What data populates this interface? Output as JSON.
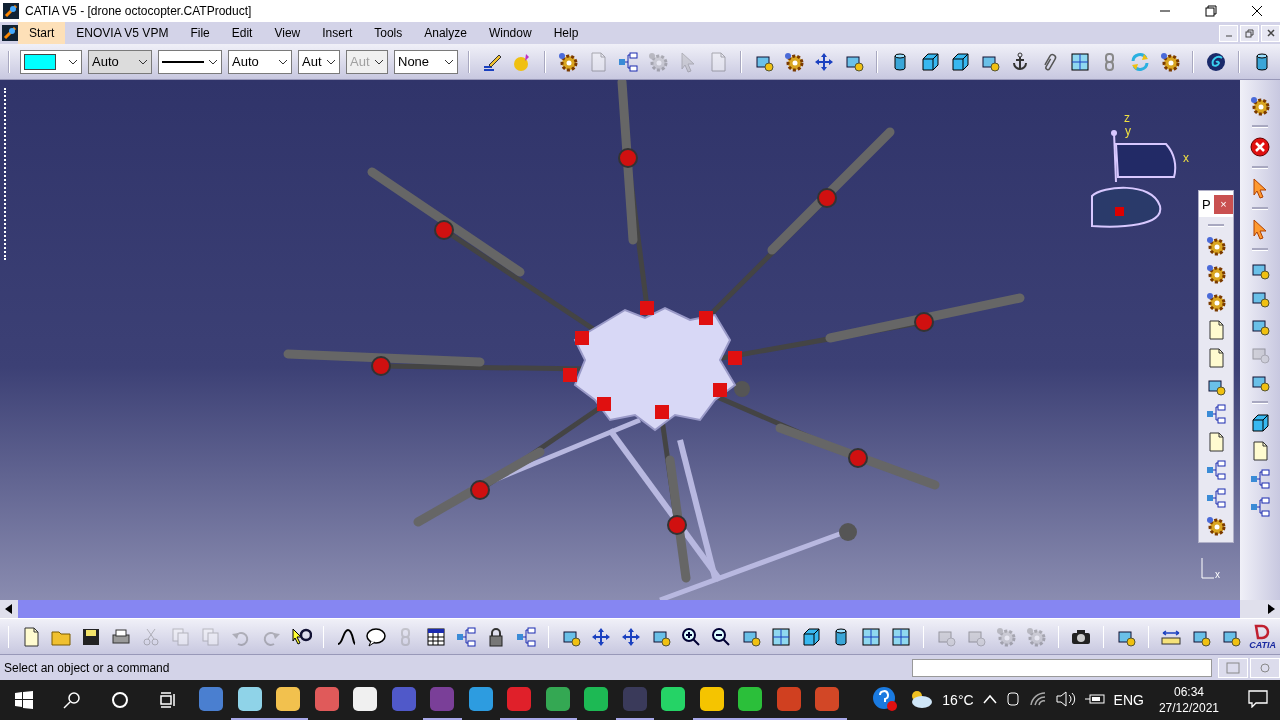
{
  "window": {
    "title": "CATIA V5 - [drone octocopter.CATProduct]"
  },
  "menu": [
    {
      "label": "Start",
      "selected": true
    },
    {
      "label": "ENOVIA V5 VPM",
      "selected": false
    },
    {
      "label": "File",
      "selected": false
    },
    {
      "label": "Edit",
      "selected": false
    },
    {
      "label": "View",
      "selected": false
    },
    {
      "label": "Insert",
      "selected": false
    },
    {
      "label": "Tools",
      "selected": false
    },
    {
      "label": "Analyze",
      "selected": false
    },
    {
      "label": "Window",
      "selected": false
    },
    {
      "label": "Help",
      "selected": false
    }
  ],
  "format_toolbar": [
    {
      "kind": "color",
      "color": "#00ffff",
      "disabled": false
    },
    {
      "kind": "text",
      "value": "Auto",
      "readonly": true,
      "disabled": false
    },
    {
      "kind": "line",
      "disabled": false
    },
    {
      "kind": "text",
      "value": "Auto",
      "readonly": false,
      "disabled": false
    },
    {
      "kind": "text",
      "value": "Aut",
      "readonly": false,
      "disabled": false
    },
    {
      "kind": "text",
      "value": "Aut",
      "readonly": false,
      "disabled": true
    },
    {
      "kind": "text",
      "value": "None",
      "readonly": false,
      "disabled": false
    }
  ],
  "top_toolbar": [
    [
      {
        "kind": "brush",
        "disabled": false
      },
      {
        "kind": "ball",
        "disabled": false
      }
    ],
    [
      {
        "kind": "gear",
        "disabled": false
      },
      {
        "kind": "page",
        "disabled": true
      },
      {
        "kind": "tree",
        "disabled": false
      },
      {
        "kind": "gear",
        "disabled": true
      },
      {
        "kind": "cursor",
        "disabled": true
      },
      {
        "kind": "page",
        "disabled": true
      }
    ],
    [
      {
        "kind": "tool",
        "disabled": false
      },
      {
        "kind": "gear",
        "disabled": false
      },
      {
        "kind": "move",
        "disabled": false
      },
      {
        "kind": "tool",
        "disabled": false
      }
    ],
    [
      {
        "kind": "cylinder",
        "disabled": false
      },
      {
        "kind": "cube",
        "disabled": false
      },
      {
        "kind": "cube",
        "disabled": false
      },
      {
        "kind": "tool",
        "disabled": false
      },
      {
        "kind": "anchor",
        "disabled": false
      },
      {
        "kind": "clip",
        "disabled": false
      },
      {
        "kind": "window",
        "disabled": false
      },
      {
        "kind": "link",
        "disabled": false
      },
      {
        "kind": "refresh",
        "disabled": false
      },
      {
        "kind": "gear",
        "disabled": false
      }
    ],
    [
      {
        "kind": "swirl",
        "disabled": false
      }
    ],
    [
      {
        "kind": "cylinder",
        "disabled": false
      }
    ]
  ],
  "compass": {
    "z": "z",
    "y": "y",
    "x": "x"
  },
  "floating_toolbar": {
    "title": "P",
    "close": "×",
    "icons": [
      {
        "kind": "gear",
        "disabled": false
      },
      {
        "kind": "gear",
        "disabled": false
      },
      {
        "kind": "gear",
        "disabled": false
      },
      {
        "kind": "page",
        "disabled": false
      },
      {
        "kind": "page",
        "disabled": false
      },
      {
        "kind": "tool",
        "disabled": false
      },
      {
        "kind": "tree",
        "disabled": false
      },
      {
        "kind": "page",
        "disabled": false
      },
      {
        "kind": "tree",
        "disabled": false
      },
      {
        "kind": "tree",
        "disabled": false
      },
      {
        "kind": "gear",
        "disabled": false
      }
    ]
  },
  "right_toolbar": [
    [
      {
        "kind": "gear",
        "disabled": false
      }
    ],
    [
      {
        "kind": "stop",
        "disabled": false
      }
    ],
    [
      {
        "kind": "cursor",
        "disabled": false
      }
    ],
    [
      {
        "kind": "cursor",
        "disabled": false
      }
    ],
    [
      {
        "kind": "tool",
        "disabled": false
      },
      {
        "kind": "tool",
        "disabled": false
      },
      {
        "kind": "tool",
        "disabled": false
      },
      {
        "kind": "tool",
        "disabled": true
      },
      {
        "kind": "tool",
        "disabled": false
      }
    ],
    [
      {
        "kind": "cube",
        "disabled": false
      },
      {
        "kind": "page",
        "disabled": false
      },
      {
        "kind": "tree",
        "disabled": false
      },
      {
        "kind": "tree",
        "disabled": false
      }
    ]
  ],
  "axis_corner": {
    "x": "x"
  },
  "bottom_toolbar": [
    [
      {
        "kind": "page",
        "disabled": false
      },
      {
        "kind": "folder",
        "disabled": false
      },
      {
        "kind": "floppy",
        "disabled": false
      },
      {
        "kind": "printer",
        "disabled": false
      },
      {
        "kind": "scissors",
        "disabled": true
      },
      {
        "kind": "copy",
        "disabled": true
      },
      {
        "kind": "copy",
        "disabled": true
      },
      {
        "kind": "undo",
        "disabled": true
      },
      {
        "kind": "redo",
        "disabled": true
      },
      {
        "kind": "help",
        "disabled": false
      }
    ],
    [
      {
        "kind": "curve",
        "disabled": false
      },
      {
        "kind": "comment",
        "disabled": false
      },
      {
        "kind": "link",
        "disabled": true
      },
      {
        "kind": "table",
        "disabled": false
      },
      {
        "kind": "tree",
        "disabled": false
      },
      {
        "kind": "lock",
        "disabled": false
      },
      {
        "kind": "tree",
        "disabled": false
      }
    ],
    [
      {
        "kind": "tool",
        "disabled": false
      },
      {
        "kind": "move",
        "disabled": false
      },
      {
        "kind": "move",
        "disabled": false
      },
      {
        "kind": "tool",
        "disabled": false
      },
      {
        "kind": "zoomin",
        "disabled": false
      },
      {
        "kind": "zoomout",
        "disabled": false
      },
      {
        "kind": "tool",
        "disabled": false
      },
      {
        "kind": "window",
        "disabled": false
      },
      {
        "kind": "cube",
        "disabled": false
      },
      {
        "kind": "cylinder",
        "disabled": false
      },
      {
        "kind": "window",
        "disabled": false
      },
      {
        "kind": "window",
        "disabled": false
      }
    ],
    [
      {
        "kind": "tool",
        "disabled": true
      },
      {
        "kind": "tool",
        "disabled": true
      },
      {
        "kind": "gear",
        "disabled": true
      },
      {
        "kind": "gear",
        "disabled": true
      }
    ],
    [
      {
        "kind": "camera",
        "disabled": false
      }
    ],
    [
      {
        "kind": "tool",
        "disabled": false
      }
    ],
    [
      {
        "kind": "ruler",
        "disabled": false
      },
      {
        "kind": "tool",
        "disabled": false
      },
      {
        "kind": "tool",
        "disabled": false
      }
    ]
  ],
  "brand": {
    "logo": "CATIA"
  },
  "status_bar": {
    "message": "Select an object or a command"
  },
  "taskbar": {
    "apps": [
      {
        "color": "#4a7fd0",
        "running": false
      },
      {
        "color": "#8fd3e8",
        "running": true
      },
      {
        "color": "#f2c14e",
        "running": true
      },
      {
        "color": "#e05a5a",
        "running": false
      },
      {
        "color": "#f0f0f0",
        "running": false
      },
      {
        "color": "#5059c9",
        "running": false
      },
      {
        "color": "#7a3f98",
        "running": true
      },
      {
        "color": "#2d9ce0",
        "running": false
      },
      {
        "color": "#e0202a",
        "running": true
      },
      {
        "color": "#34a853",
        "running": true
      },
      {
        "color": "#1db954",
        "running": false
      },
      {
        "color": "#3a3a5a",
        "running": true
      },
      {
        "color": "#25d366",
        "running": false
      },
      {
        "color": "#f5c400",
        "running": true
      },
      {
        "color": "#2bbf3a",
        "running": true
      },
      {
        "color": "#d04020",
        "running": true
      },
      {
        "color": "#d24726",
        "running": true
      }
    ],
    "weather": "16°C",
    "language": "ENG",
    "time": "06:34",
    "date": "27/12/2021"
  }
}
